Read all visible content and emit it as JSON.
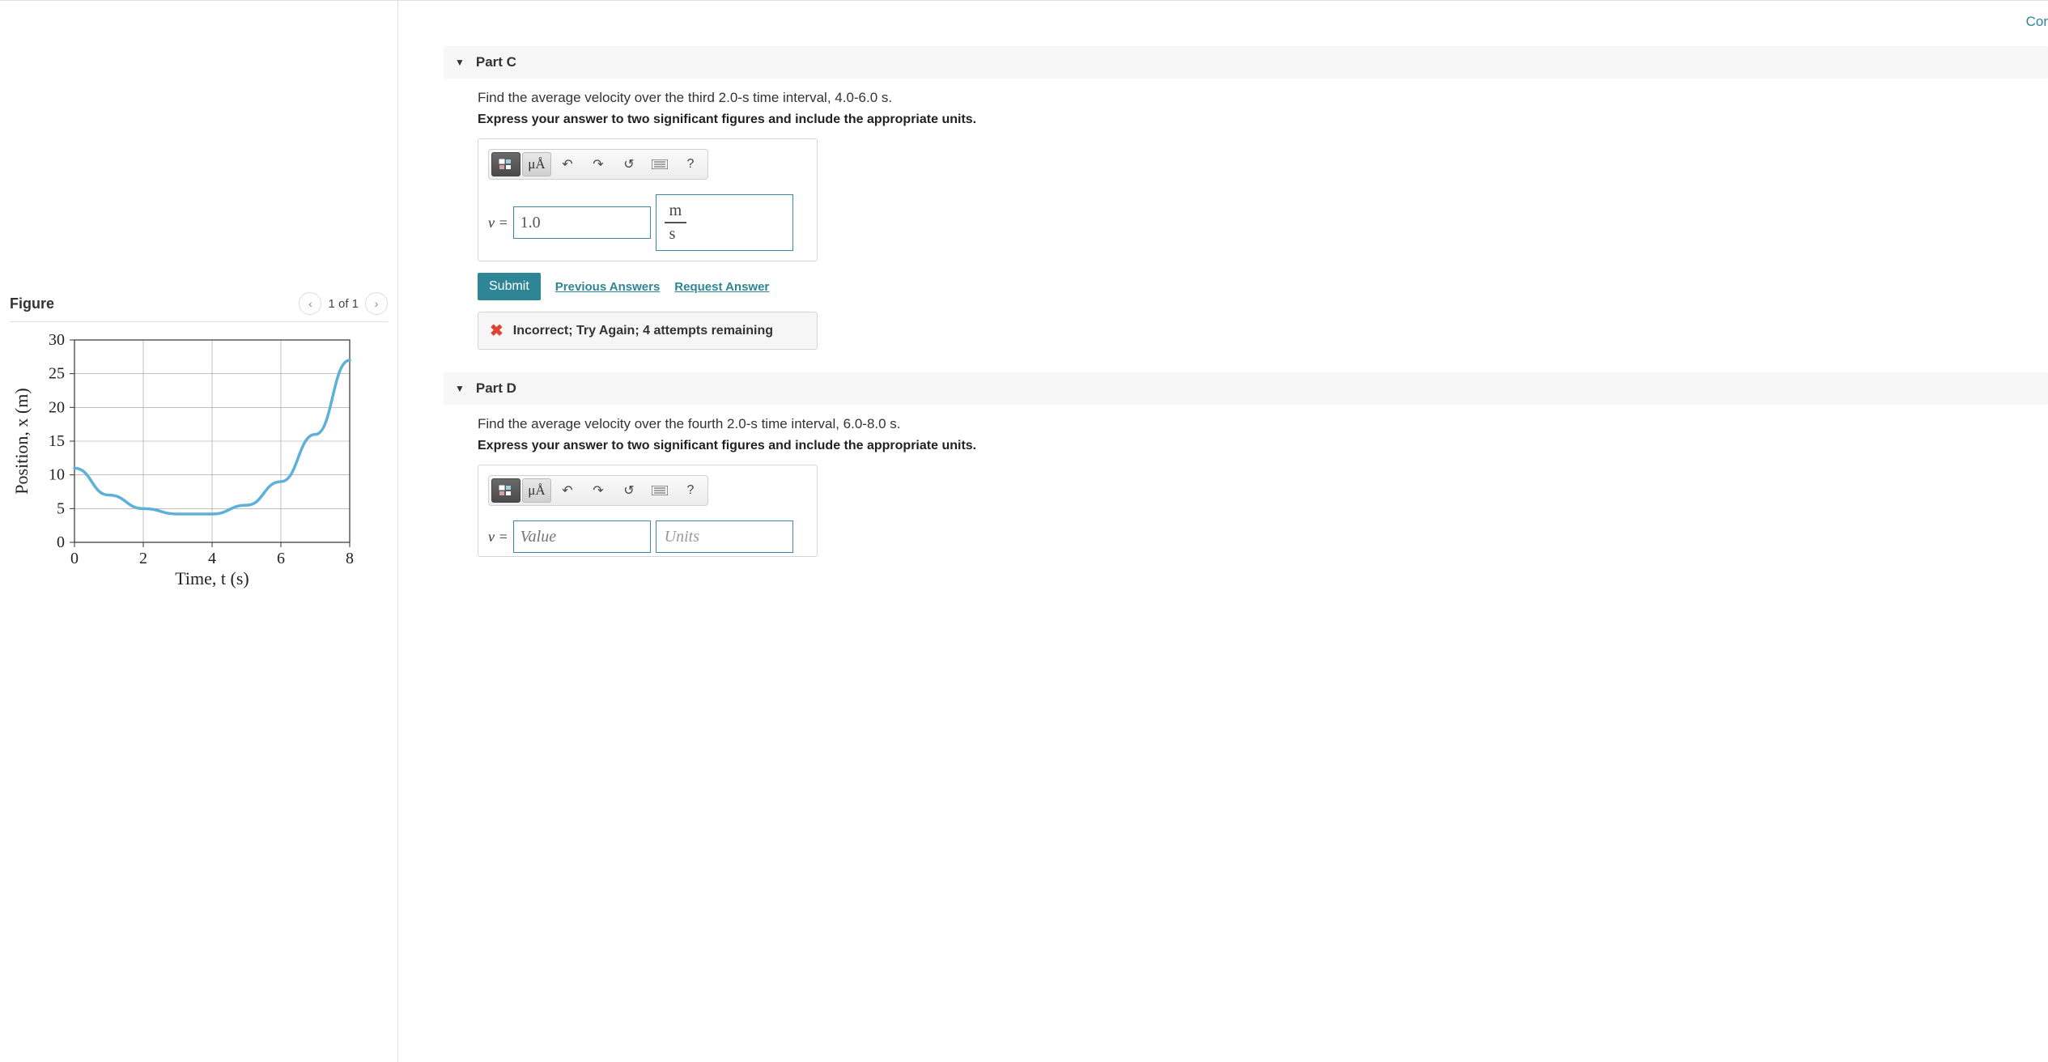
{
  "top_right": "Cor",
  "figure": {
    "title": "Figure",
    "nav": "1 of 1",
    "xlabel_tex": "Time, t (s)",
    "ylabel_tex": "Position, x (m)"
  },
  "chart_data": {
    "type": "line",
    "title": "",
    "xlabel": "Time, t (s)",
    "ylabel": "Position, x (m)",
    "xlim": [
      0,
      8
    ],
    "ylim": [
      0,
      30
    ],
    "x_ticks": [
      0,
      2,
      4,
      6,
      8
    ],
    "y_ticks": [
      0,
      5,
      10,
      15,
      20,
      25,
      30
    ],
    "x": [
      0.0,
      1.0,
      2.0,
      3.0,
      4.0,
      5.0,
      6.0,
      7.0,
      8.0
    ],
    "y": [
      11.0,
      7.0,
      5.0,
      4.2,
      4.2,
      5.5,
      9.0,
      16.0,
      27.0
    ]
  },
  "toolbar": {
    "sym_ua": "μÅ",
    "help": "?"
  },
  "partC": {
    "title": "Part C",
    "prompt": "Find the average velocity over the third 2.0-s time interval, 4.0-6.0 s.",
    "instruction": "Express your answer to two significant figures and include the appropriate units.",
    "var": "v =",
    "value": "1.0",
    "unit_top": "m",
    "unit_bot": "s",
    "submit": "Submit",
    "prev": "Previous Answers",
    "req": "Request Answer",
    "feedback": "Incorrect; Try Again; 4 attempts remaining"
  },
  "partD": {
    "title": "Part D",
    "prompt": "Find the average velocity over the fourth 2.0-s time interval, 6.0-8.0 s.",
    "instruction": "Express your answer to two significant figures and include the appropriate units.",
    "var": "v =",
    "value_placeholder": "Value",
    "unit_placeholder": "Units"
  }
}
